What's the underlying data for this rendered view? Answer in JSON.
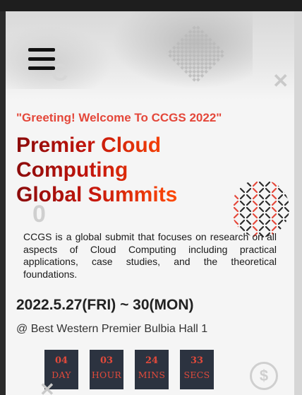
{
  "header": {
    "menu_icon": "hamburger-menu-icon"
  },
  "hero": {
    "greeting": "\"Greeting! Welcome To CCGS 2022\"",
    "title_lines": [
      "Premier Cloud",
      "Computing",
      "Global Summits"
    ],
    "description": "CCGS is a global submit that focuses on research on all aspects of Cloud Computing including practical applications, case studies, and the theoretical foundations.",
    "date": "2022.5.27(FRI) ~ 30(MON)",
    "venue": "@ Best Western Premier Bulbia Hall 1"
  },
  "countdown": [
    {
      "value": "04",
      "label": "DAY"
    },
    {
      "value": "03",
      "label": "HOUR"
    },
    {
      "value": "24",
      "label": "MINS"
    },
    {
      "value": "33",
      "label": "SECS"
    }
  ],
  "colors": {
    "accent": "#e4473a",
    "title_start": "#8b0b0b",
    "title_end": "#ff4a05",
    "countdown_bg": "#2c3340"
  }
}
